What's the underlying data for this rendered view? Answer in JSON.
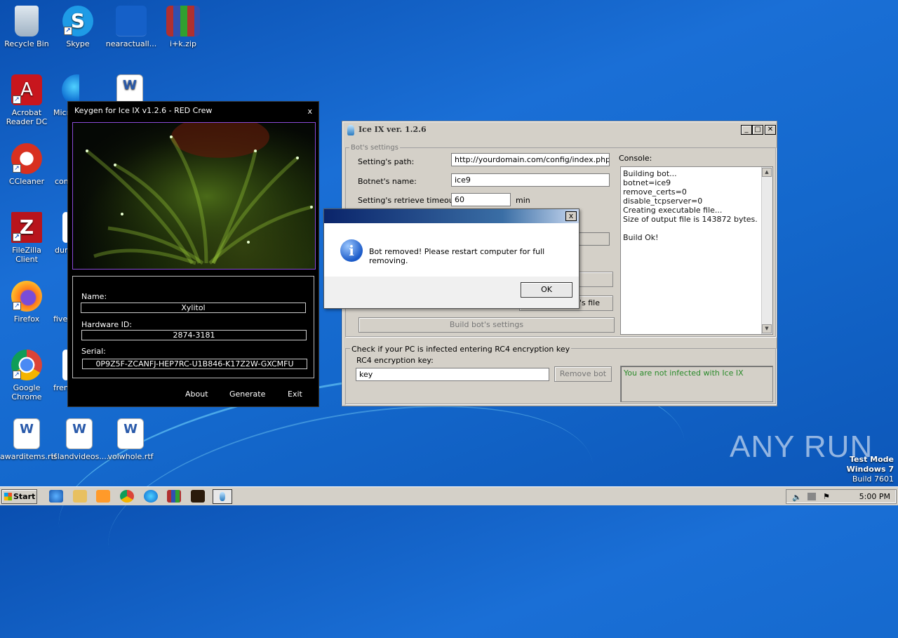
{
  "desktop": {
    "icons": [
      {
        "label": "Recycle Bin",
        "icon": "recycle-bin-icon"
      },
      {
        "label": "Skype",
        "icon": "skype-icon"
      },
      {
        "label": "nearactuall...",
        "icon": "file-icon"
      },
      {
        "label": "i+k.zip",
        "icon": "winrar-icon"
      },
      {
        "label": "Acrobat Reader DC",
        "icon": "acrobat-icon"
      },
      {
        "label": "Micr",
        "icon": "edge-icon"
      },
      {
        "label": "CCleaner",
        "icon": "ccleaner-icon"
      },
      {
        "label": "com",
        "icon": "file-icon"
      },
      {
        "label": "FileZilla Client",
        "icon": "filezilla-icon"
      },
      {
        "label": "duri",
        "icon": "file-icon"
      },
      {
        "label": "Firefox",
        "icon": "firefox-icon"
      },
      {
        "label": "five",
        "icon": "file-icon"
      },
      {
        "label": "Google Chrome",
        "icon": "chrome-icon"
      },
      {
        "label": "fren",
        "icon": "file-icon"
      },
      {
        "label": "awarditems.rtf",
        "icon": "word-doc-icon"
      },
      {
        "label": "islandvideos....",
        "icon": "word-doc-icon"
      },
      {
        "label": "volwhole.rtf",
        "icon": "word-doc-icon"
      }
    ]
  },
  "keygen": {
    "title": "Keygen for Ice IX v1.2.6 - RED Crew",
    "close": "x",
    "name_label": "Name:",
    "name_value": "Xylitol",
    "hwid_label": "Hardware ID:",
    "hwid_value": "2874-3181",
    "serial_label": "Serial:",
    "serial_value": "0P9Z5F-ZCANFJ-HEP7RC-U1B846-K17Z2W-GXCMFU",
    "about": "About",
    "generate": "Generate",
    "exit": "Exit"
  },
  "iceix": {
    "title": "Ice IX ver. 1.2.6",
    "group_bot": "Bot's settings",
    "settings_path_label": "Setting's path:",
    "settings_path_value": "http://yourdomain.com/config/index.php",
    "botnet_label": "Botnet's name:",
    "botnet_value": "ice9",
    "timeout_label": "Setting's retrieve timeout:",
    "timeout_value": "60",
    "timeout_unit": "min",
    "partial_button": "n's file",
    "build_settings": "Build bot's settings",
    "console_label": "Console:",
    "console_lines": [
      "Building bot...",
      "botnet=ice9",
      "remove_certs=0",
      "disable_tcpserver=0",
      "Creating executable file...",
      "Size of output file is 143872 bytes.",
      "",
      "Build Ok!"
    ],
    "group_rc4": "Check if your PC is infected entering RC4 encryption key",
    "rc4_label": "RC4 encryption key:",
    "rc4_value": "key",
    "remove_bot": "Remove bot",
    "status": "You are not infected with Ice IX",
    "status_color": "#2a8a2a"
  },
  "dialog": {
    "message": "Bot removed! Please restart computer for full removing.",
    "ok": "OK",
    "close": "x"
  },
  "taskbar": {
    "start": "Start",
    "clock": "5:00 PM"
  },
  "watermark": {
    "brand": "ANY RUN",
    "line1": "Test Mode",
    "line2": "Windows 7",
    "line3": "Build 7601"
  }
}
